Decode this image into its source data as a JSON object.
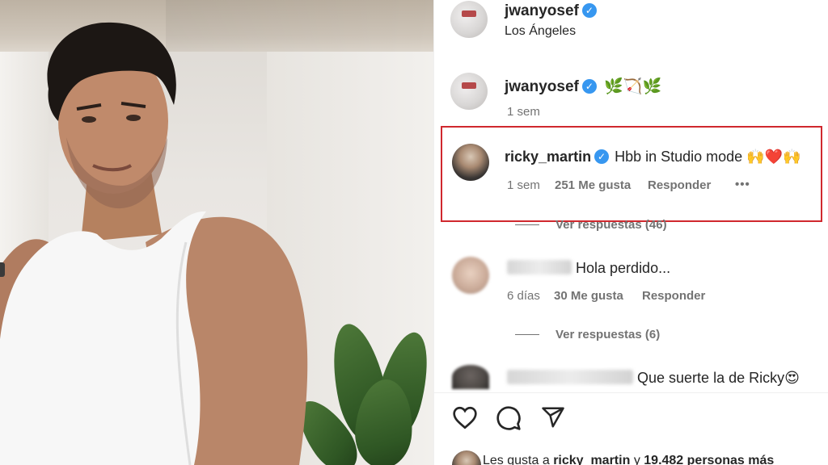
{
  "post": {
    "author": "jwanyosef",
    "location": "Los Ángeles"
  },
  "caption": {
    "author": "jwanyosef",
    "emojis": "🌿🏹🌿",
    "time": "1 sem"
  },
  "comments": [
    {
      "author": "ricky_martin",
      "text": "Hbb in Studio mode 🙌❤️🙌",
      "time": "1 sem",
      "likes": "251 Me gusta",
      "reply": "Responder",
      "more": "•••",
      "view_replies": "Ver respuestas (46)"
    },
    {
      "author_redacted": true,
      "text": "Hola perdido...",
      "time": "6 días",
      "likes": "30 Me gusta",
      "reply": "Responder",
      "view_replies": "Ver respuestas (6)"
    },
    {
      "author_redacted": true,
      "text": "Que suerte la de Ricky😍"
    }
  ],
  "actions": {
    "like": "heart-icon",
    "comment": "comment-icon",
    "share": "share-icon"
  },
  "likes_summary": {
    "prefix": "Les gusta a",
    "user": "ricky_martin",
    "middle": "y",
    "count": "19.482 personas más"
  },
  "colors": {
    "verified": "#3797f0",
    "highlight": "#d0282e",
    "muted": "#737373"
  }
}
